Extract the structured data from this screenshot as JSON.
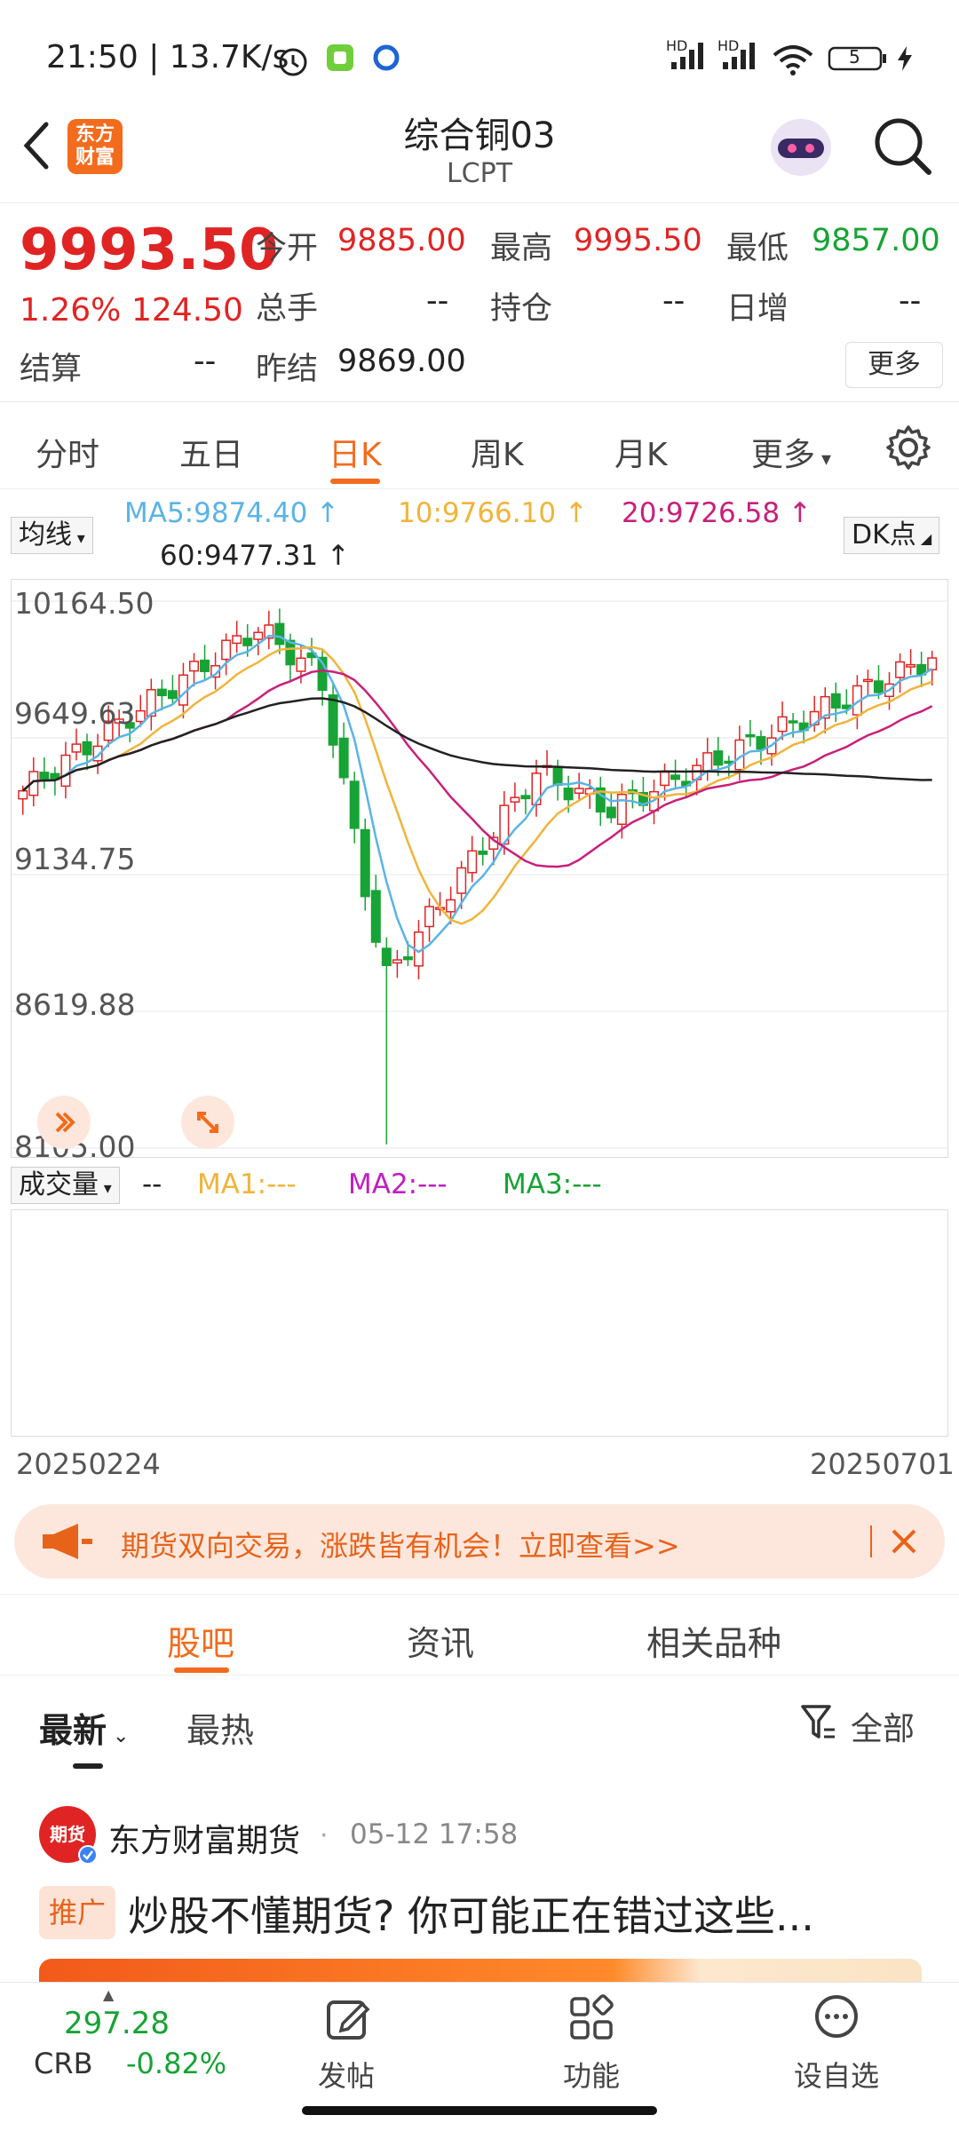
{
  "status": {
    "time": "21:50",
    "speed": "13.7K/s",
    "signal1": "HD",
    "signal2": "HD",
    "battery": "5"
  },
  "header": {
    "title": "综合铜03",
    "code": "LCPT",
    "logo_text": "东方\n财富"
  },
  "quote": {
    "price": "9993.50",
    "change_pct": "1.26%",
    "change_abs": "124.50",
    "fields": [
      {
        "label": "今开",
        "value": "9885.00",
        "color": "red"
      },
      {
        "label": "最高",
        "value": "9995.50",
        "color": "red"
      },
      {
        "label": "最低",
        "value": "9857.00",
        "color": "green"
      },
      {
        "label": "总手",
        "value": "--",
        "color": "dark"
      },
      {
        "label": "持仓",
        "value": "--",
        "color": "dark"
      },
      {
        "label": "日增",
        "value": "--",
        "color": "dark"
      },
      {
        "label": "结算",
        "value": "--",
        "color": "dark"
      },
      {
        "label": "昨结",
        "value": "9869.00",
        "color": "dark"
      }
    ],
    "more_label": "更多"
  },
  "tabs": {
    "items": [
      "分时",
      "五日",
      "日K",
      "周K",
      "月K",
      "更多"
    ],
    "active": "日K"
  },
  "ma": {
    "selector": "均线",
    "ma5": "MA5:9874.40",
    "ma10": "10:9766.10",
    "ma20": "20:9726.58",
    "ma60": "60:9477.31",
    "dk_label": "DK点",
    "colors": {
      "ma5": "#5ab4e5",
      "ma10": "#f0b43a",
      "ma20": "#c8207a",
      "ma60": "#222222",
      "up": "#e02424",
      "down": "#17a335"
    }
  },
  "chart_data": {
    "type": "candlestick",
    "y_ticks": [
      "10164.50",
      "9649.63",
      "9134.75",
      "8619.88",
      "8105.00"
    ],
    "ylim": [
      8105.0,
      10164.5
    ],
    "x_start": "20250224",
    "x_end": "20250701"
  },
  "volume": {
    "selector": "成交量",
    "dash": "--",
    "ma1": "MA1:---",
    "ma2": "MA2:---",
    "ma3": "MA3:---"
  },
  "banner": {
    "text": "期货双向交易，涨跌皆有机会！立即查看>>"
  },
  "sub_tabs": {
    "items": [
      "股吧",
      "资讯",
      "相关品种"
    ],
    "active": "股吧"
  },
  "filter": {
    "latest": "最新",
    "hot": "最热",
    "all": "全部"
  },
  "post": {
    "author": "东方财富期货",
    "time": "05-12 17:58",
    "tag": "推广",
    "title": "炒股不懂期货? 你可能正在错过这些...",
    "avatar_text": "期货"
  },
  "bottom_nav": {
    "crb_value": "297.28",
    "crb_label": "CRB",
    "crb_change": "-0.82%",
    "items": [
      "发帖",
      "功能",
      "设自选"
    ]
  }
}
